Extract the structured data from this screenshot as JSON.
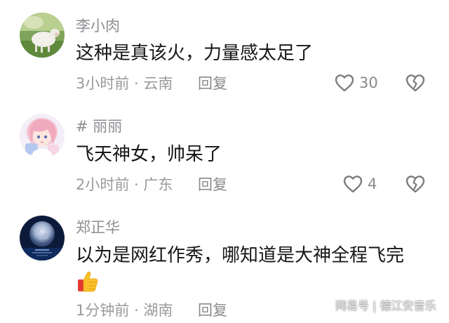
{
  "comments": [
    {
      "username": "李小肉",
      "text": "这种是真该火，力量感太足了",
      "time": "3小时前 · 云南",
      "reply_label": "回复",
      "like_count": "30",
      "avatar_icon": "sheep-avatar"
    },
    {
      "username": "# 丽丽",
      "text": "飞天神女，帅呆了",
      "time": "2小时前 · 广东",
      "reply_label": "回复",
      "like_count": "4",
      "avatar_icon": "anime-girl-avatar"
    },
    {
      "username": "郑正华",
      "text": "以为是网红作秀，哪知道是大神全程飞完",
      "emoji": "thumbs-up-emoji",
      "time": "1分钟前 · 湖南",
      "reply_label": "回复",
      "avatar_icon": "moon-over-sea-avatar"
    }
  ],
  "watermark": "网易号 | 德江安音乐",
  "colors": {
    "username": "#8e8e93",
    "text": "#161616",
    "meta": "#9a9a9a",
    "icon": "#7d7d7d"
  }
}
